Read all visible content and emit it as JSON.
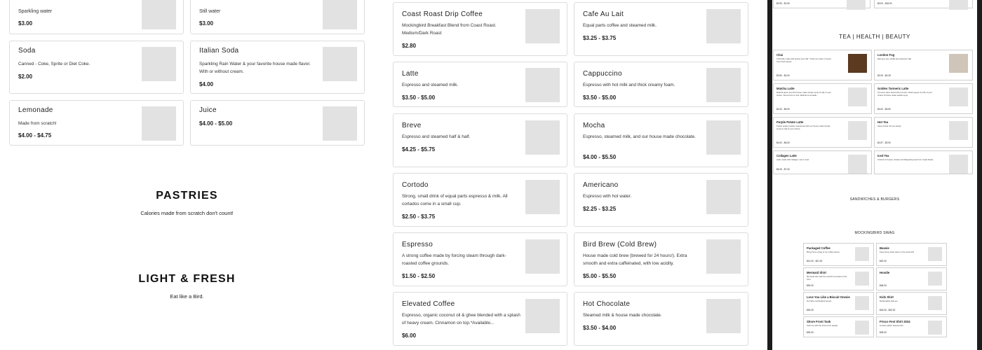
{
  "left_column": {
    "cards": [
      {
        "title": "Sparkling water",
        "price": "$3.00"
      },
      {
        "title": "Still water",
        "price": "$3.00"
      },
      {
        "title": "Soda",
        "desc": "Canned - Coke, Sprite or Diet Coke.",
        "price": "$2.00"
      },
      {
        "title": "Italian Soda",
        "desc": "Sparkling Rain Water & your favorite house made flavor. With or without cream.",
        "price": "$4.00"
      },
      {
        "title": "Lemonade",
        "desc": "Made from scratch!",
        "price": "$4.00 - $4.75"
      },
      {
        "title": "Juice",
        "price": "$4.00 - $5.00"
      }
    ],
    "pastries": {
      "title": "PASTRIES",
      "subtitle": "Calories made from scratch don't count!"
    },
    "light_fresh": {
      "title": "LIGHT & FRESH",
      "subtitle": "Eat like a Bird."
    }
  },
  "menu": {
    "items": [
      {
        "title": "Coast Roast Drip Coffee",
        "desc": "Mockingbird Breakfast Blend from Coast Roast. Medium/Dark Roast",
        "price": "$2.80"
      },
      {
        "title": "Cafe Au Lait",
        "desc": "Equal parts coffee and steamed milk.",
        "price": "$3.25 - $3.75"
      },
      {
        "title": "Latte",
        "desc": "Espresso and steamed milk.",
        "price": "$3.50 - $5.00"
      },
      {
        "title": "Cappuccino",
        "desc": "Espresso with hot milk and thick creamy foam.",
        "price": "$3.50 - $5.00"
      },
      {
        "title": "Breve",
        "desc": "Espresso and steamed half & half.",
        "price": "$4.25 - $5.75"
      },
      {
        "title": "Mocha",
        "desc": "Espresso, steamed milk, and our house made chocolate.",
        "price": "$4.00 - $5.50"
      },
      {
        "title": "Cortodo",
        "desc": "Strong, small drink of equal parts espresso & milk. All cortados come in a small cup.",
        "price": "$2.50 - $3.75"
      },
      {
        "title": "Americano",
        "desc": "Espresso with hot water.",
        "price": "$2.25 - $3.25"
      },
      {
        "title": "Espresso",
        "desc": "A strong coffee made by forcing steam through dark-roasted coffee grounds.",
        "price": "$1.50 - $2.50"
      },
      {
        "title": "Bird Brew (Cold Brew)",
        "desc": "House made cold brew (brewed for 24 hours!). Extra smooth and extra caffeinated, with low acidity.",
        "price": "$5.00 - $5.50"
      },
      {
        "title": "Elevated Coffee",
        "desc": "Espresso, organic coconut oil & ghee blended with a splash of heavy cream. Cinnamon on top.*Available...",
        "price": "$6.00"
      },
      {
        "title": "Hot Chocolate",
        "desc": "Steamed milk & house made chocolate.",
        "price": "$3.50 - $4.00"
      }
    ]
  },
  "right_panel": {
    "top_prices": [
      "$0.93 - $1.50",
      "$0.00 - $18.00"
    ],
    "tea_heading": "TEA | HEALTH | BEAUTY",
    "tea_items": [
      {
        "title": "Chai",
        "desc": "Chai latte made with spices and milk. *Chai mix made in house from fresh spices.",
        "price": "$3.50 - $4.00"
      },
      {
        "title": "London Fog",
        "desc": "Earl grey tea, vanilla and steamed milk",
        "price": "$3.25 - $4.25"
      },
      {
        "title": "Matcha Latte",
        "desc": "Matcha green tea with house made simple syrup & milk of your choice. Served hot or iced. Matcha Lemonade...",
        "price": "$4.00 - $6.00"
      },
      {
        "title": "Golden Turmeric Latte",
        "desc": "Turmeric spice blend with turmeric, black pepper & milk of your choice & house made vanilla syrup.",
        "price": "$4.00 - $6.50"
      },
      {
        "title": "Purple Potato Latte",
        "desc": "Purple potato powder sweetened with our house made simple syrup & milk of your choice.",
        "price": "$4.00 - $6.00"
      },
      {
        "title": "Hot Tea",
        "desc": "Steep brand hot tea variety.",
        "price": "$1.87 - $3.00"
      },
      {
        "title": "Collagen Latte",
        "desc": "Latte made with collagen. Hot or iced.",
        "price": "$5.25 - $7.00"
      },
      {
        "title": "Iced Tea",
        "desc": "A blend of Ceylon, Assam and Darjeeling teas from Coast Roast.",
        "price": ""
      }
    ],
    "sandwiches_heading": "SANDWICHES & BURGERS",
    "swag_heading": "MOCKINGBIRD SWAG",
    "swag_items": [
      {
        "title": "Packaged Coffee",
        "desc": "Bring home a bag of our coffee beans",
        "price": "$14.00 - $21.00"
      },
      {
        "title": "Beanie",
        "desc": "Keep those locks warm in the wind-chill",
        "price": "$20.00"
      },
      {
        "title": "Mermaid Shirt",
        "desc": "Mermaid shirt with the colorful mermaid on the front",
        "price": "$30.00"
      },
      {
        "title": "Hoodie",
        "desc": "",
        "price": "$48.00"
      },
      {
        "title": "Love You Like a Biscuit Onesie",
        "desc": "Our little mockingbird onesie",
        "price": "$25.00"
      },
      {
        "title": "Kids Shirt",
        "desc": "Mockingbird kids tee",
        "price": "$18.00 - $20.00"
      },
      {
        "title": "Shore Front Tank",
        "desc": "Tank top with the shore front design",
        "price": "$30.00"
      },
      {
        "title": "Frisco Fest Shirt 2024",
        "desc": "Limited edition festival shirt",
        "price": "$35.00"
      }
    ]
  }
}
